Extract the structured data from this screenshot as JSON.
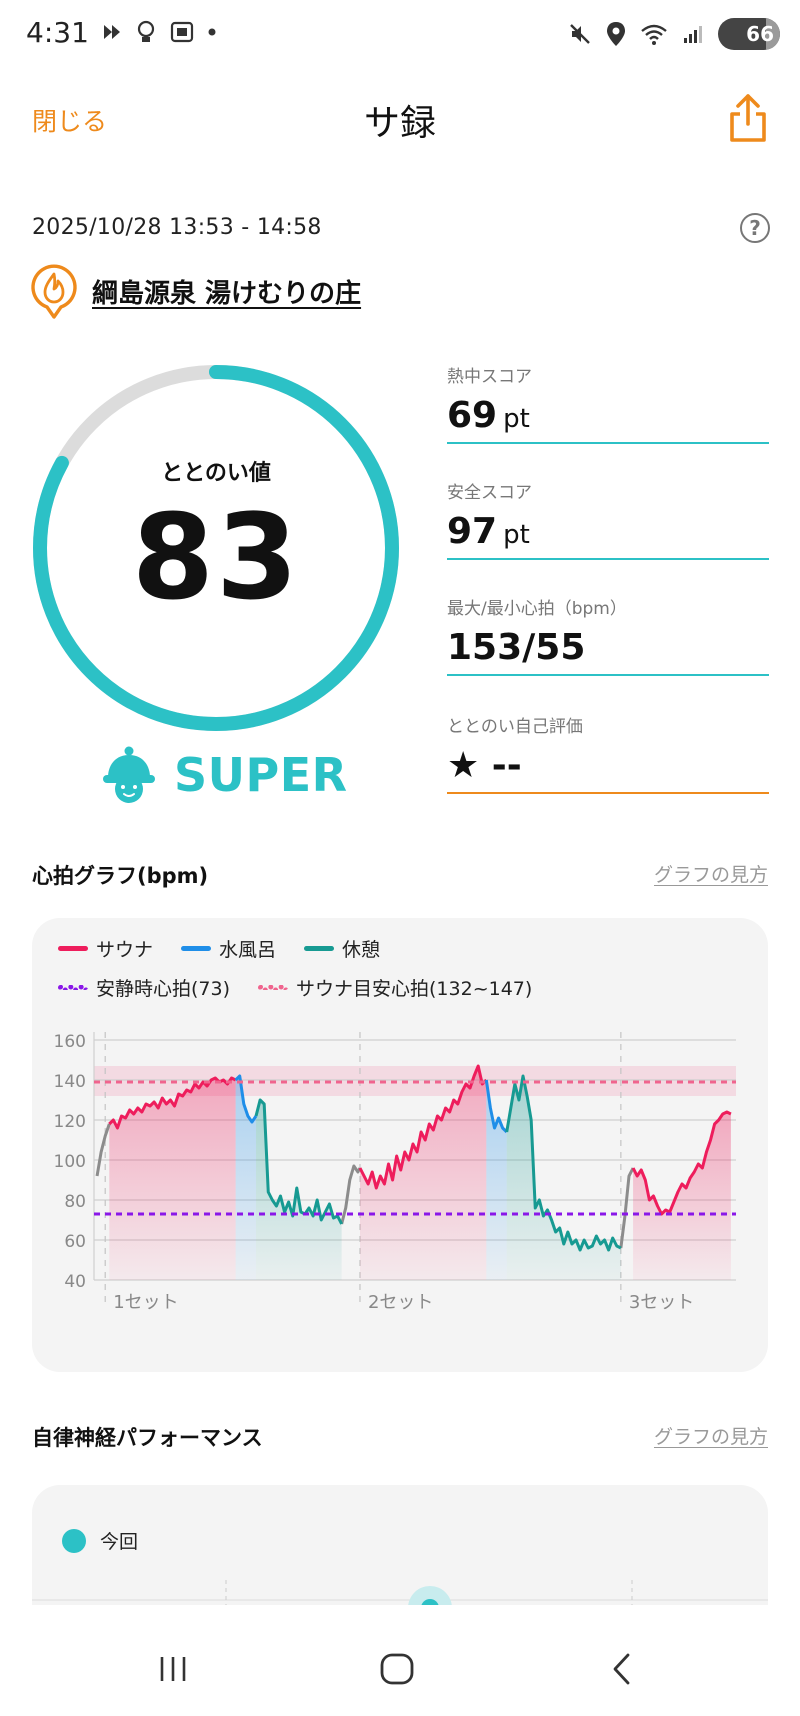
{
  "status_bar": {
    "time": "4:31",
    "battery": "66"
  },
  "header": {
    "close_label": "閉じる",
    "title": "サ録"
  },
  "session": {
    "datetime": "2025/10/28 13:53 - 14:58",
    "facility": "綱島源泉 湯けむりの庄"
  },
  "totonoi": {
    "label": "ととのい値",
    "value": "83",
    "max": 100,
    "rank": "SUPER",
    "ring_color": "#2cc1c6"
  },
  "metrics": [
    {
      "label": "熱中スコア",
      "value": "69",
      "unit": "pt"
    },
    {
      "label": "安全スコア",
      "value": "97",
      "unit": "pt"
    },
    {
      "label": "最大/最小心拍（bpm）",
      "value": "153/55",
      "unit": ""
    },
    {
      "label": "ととのい自己評価",
      "value": "★ --",
      "unit": ""
    }
  ],
  "heart_section": {
    "title": "心拍グラフ(bpm)",
    "link": "グラフの見方"
  },
  "legend": {
    "sauna": "サウナ",
    "water": "水風呂",
    "rest": "休憩",
    "resting_hr": "安静時心拍(73)",
    "sauna_target": "サウナ目安心拍(132~147)"
  },
  "colors": {
    "sauna": "#ee1d5c",
    "water": "#1f8ee8",
    "rest": "#179a92",
    "accent": "#ee8a1c",
    "resting": "#8a17e8",
    "target": "#f0648e"
  },
  "chart_data": {
    "type": "line",
    "ylim": [
      40,
      160
    ],
    "yticks": [
      "160",
      "140",
      "120",
      "100",
      "80",
      "60",
      "40"
    ],
    "set_labels": [
      "1セット",
      "2セット",
      "3セット"
    ],
    "resting_hr": 73,
    "target_band": [
      132,
      147
    ],
    "target_line": 139,
    "series": [
      {
        "name": "サウナ",
        "x": [
          0.0,
          0.4,
          0.8,
          1.2,
          1.6,
          2.0,
          2.4,
          2.8,
          3.2,
          3.6,
          4.0,
          4.4,
          4.8,
          5.2,
          5.6,
          6.0,
          6.4,
          6.8,
          7.2,
          7.6,
          8.0,
          8.4,
          8.8,
          9.2,
          9.6,
          10.0,
          10.4,
          10.8,
          11.2,
          11.6,
          12.0,
          12.4
        ],
        "values": [
          118,
          120,
          116,
          122,
          121,
          125,
          123,
          126,
          124,
          128,
          127,
          129,
          126,
          131,
          128,
          130,
          127,
          133,
          132,
          135,
          134,
          138,
          136,
          139,
          137,
          140,
          141,
          139,
          140,
          138,
          141,
          140
        ]
      },
      {
        "name": "水風呂",
        "x": [
          12.4,
          12.8,
          13.2,
          13.6,
          14.0,
          14.4
        ],
        "values": [
          140,
          142,
          128,
          122,
          119,
          122
        ]
      },
      {
        "name": "休憩",
        "x": [
          14.4,
          14.8,
          15.2,
          15.6,
          16.0,
          16.4,
          16.8,
          17.2,
          17.6,
          18.0,
          18.4,
          18.8,
          19.2,
          19.6,
          20.0,
          20.4,
          20.8,
          21.2,
          21.6,
          22.0,
          22.4,
          22.8
        ],
        "values": [
          122,
          130,
          128,
          84,
          80,
          77,
          82,
          74,
          79,
          72,
          86,
          74,
          73,
          76,
          72,
          80,
          70,
          74,
          78,
          71,
          72,
          68
        ]
      },
      {
        "name": "サウナ",
        "x": [
          24.6,
          25.0,
          25.4,
          25.8,
          26.2,
          26.6,
          27.0,
          27.4,
          27.8,
          28.2,
          28.6,
          29.0,
          29.4,
          29.8,
          30.2,
          30.6,
          31.0,
          31.4,
          31.8,
          32.2,
          32.6,
          33.0,
          33.4,
          33.8,
          34.2,
          34.6,
          35.0,
          35.4,
          35.8,
          36.2,
          36.6,
          37.0
        ],
        "values": [
          96,
          92,
          88,
          94,
          86,
          92,
          88,
          98,
          90,
          102,
          95,
          104,
          100,
          108,
          104,
          114,
          110,
          118,
          115,
          122,
          120,
          126,
          124,
          130,
          128,
          134,
          138,
          136,
          142,
          147,
          138,
          140
        ]
      },
      {
        "name": "水風呂",
        "x": [
          37.0,
          37.4,
          37.8,
          38.2,
          38.6,
          39.0
        ],
        "values": [
          140,
          126,
          116,
          121,
          116,
          114
        ]
      },
      {
        "name": "休憩",
        "x": [
          39.0,
          39.4,
          39.8,
          40.2,
          40.6,
          41.0,
          41.4,
          41.8,
          42.2,
          42.6,
          43.0,
          43.4,
          43.8,
          44.2,
          44.6,
          45.0,
          45.4,
          45.8,
          46.2,
          46.6,
          47.0,
          47.4,
          47.8,
          48.2,
          48.6,
          49.0,
          49.4,
          49.8,
          50.2
        ],
        "values": [
          114,
          126,
          138,
          130,
          142,
          132,
          120,
          76,
          80,
          72,
          75,
          70,
          64,
          66,
          58,
          64,
          58,
          60,
          55,
          60,
          56,
          57,
          62,
          58,
          60,
          55,
          61,
          57,
          56
        ]
      },
      {
        "name": "サウナ",
        "x": [
          51.4,
          51.8,
          52.2,
          52.6,
          53.0,
          53.4,
          53.8,
          54.2,
          54.6,
          55.0,
          55.4,
          55.8,
          56.2,
          56.6,
          57.0,
          57.4,
          57.8,
          58.2,
          58.6,
          59.0,
          59.4,
          59.8,
          60.2,
          60.6,
          61.0
        ],
        "values": [
          96,
          92,
          95,
          90,
          80,
          82,
          77,
          73,
          75,
          74,
          79,
          84,
          88,
          86,
          91,
          94,
          98,
          96,
          104,
          110,
          118,
          120,
          123,
          124,
          123
        ]
      }
    ],
    "transitions": [
      {
        "x": [
          -1.2,
          -0.8,
          -0.4,
          0.0
        ],
        "values": [
          92,
          104,
          112,
          118
        ]
      },
      {
        "x": [
          22.8,
          23.2,
          23.6,
          24.0,
          24.4,
          24.6
        ],
        "values": [
          68,
          76,
          90,
          97,
          94,
          96
        ]
      },
      {
        "x": [
          50.2,
          50.6,
          51.0,
          51.4
        ],
        "values": [
          56,
          72,
          92,
          96
        ]
      }
    ],
    "set_starts": [
      -0.4,
      24.6,
      50.2
    ],
    "xlim": [
      -1.5,
      61.5
    ]
  },
  "ans_section": {
    "title": "自律神経パフォーマンス",
    "link": "グラフの見方",
    "legend_label": "今回"
  }
}
